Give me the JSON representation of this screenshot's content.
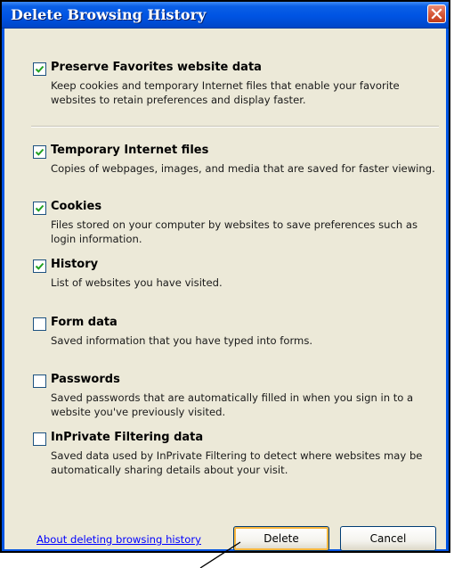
{
  "window": {
    "title": "Delete Browsing History"
  },
  "items": [
    {
      "label": "Preserve Favorites website data",
      "description": "Keep cookies and temporary Internet files that enable your favorite websites to retain preferences and display faster.",
      "checked": true
    },
    {
      "label": "Temporary Internet files",
      "description": "Copies of webpages, images, and media that are saved for faster viewing.",
      "checked": true
    },
    {
      "label": "Cookies",
      "description": "Files stored on your computer by websites to save preferences such as login information.",
      "checked": true
    },
    {
      "label": "History",
      "description": "List of websites you have visited.",
      "checked": true
    },
    {
      "label": "Form data",
      "description": "Saved information that you have typed into forms.",
      "checked": false
    },
    {
      "label": "Passwords",
      "description": "Saved passwords that are automatically filled in when you sign in to a website you've previously visited.",
      "checked": false
    },
    {
      "label": "InPrivate Filtering data",
      "description": "Saved data used by InPrivate Filtering to detect where websites may be automatically sharing details about your visit.",
      "checked": false
    }
  ],
  "footer": {
    "link": "About deleting browsing history",
    "delete_label": "Delete",
    "cancel_label": "Cancel"
  },
  "icons": {
    "close": "close-icon",
    "check": "checkmark-icon"
  },
  "colors": {
    "titlebar": "#0054e3",
    "dialog_bg": "#ece9d8",
    "close_button": "#d75a3b",
    "checkmark": "#21a121",
    "link": "#0000ff",
    "default_button_focus": "#f9b73f"
  }
}
